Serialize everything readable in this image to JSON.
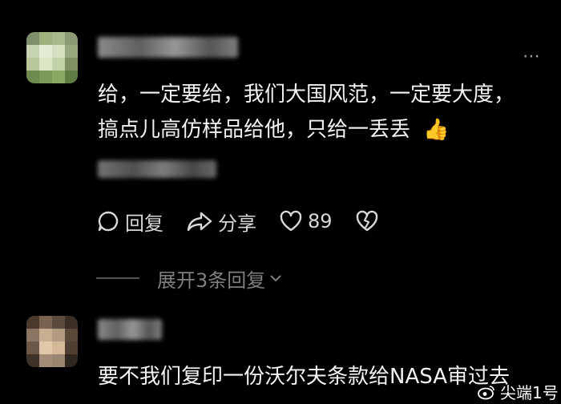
{
  "comments": [
    {
      "text_line1": "给，一定要给，我们大国风范，一定要大度，",
      "text_line2": "搞点儿高仿样品给他，只给一丢丢",
      "reaction_emoji": "👍",
      "actions": {
        "reply_label": "回复",
        "share_label": "分享",
        "like_count": "89"
      },
      "expand_label": "展开3条回复"
    },
    {
      "text_line1": "要不我们复印一份沃尔夫条款给NASA审过去"
    }
  ],
  "watermark": {
    "label": "尖端1号"
  },
  "colors": {
    "background": "#000000",
    "text": "#f2f2f2",
    "muted": "#7f7f7f"
  }
}
